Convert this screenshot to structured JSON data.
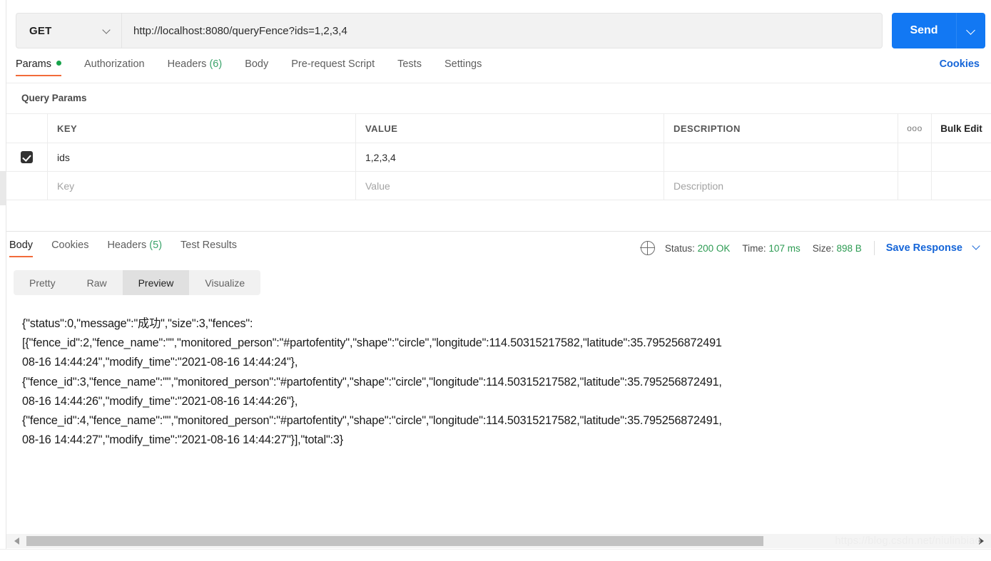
{
  "request": {
    "method": "GET",
    "url": "http://localhost:8080/queryFence?ids=1,2,3,4",
    "send_label": "Send",
    "tabs": [
      {
        "label": "Params",
        "badge_dot": true,
        "active": true
      },
      {
        "label": "Authorization",
        "active": false
      },
      {
        "label": "Headers",
        "count": "(6)",
        "active": false
      },
      {
        "label": "Body",
        "active": false
      },
      {
        "label": "Pre-request Script",
        "active": false
      },
      {
        "label": "Tests",
        "active": false
      },
      {
        "label": "Settings",
        "active": false
      }
    ],
    "cookies_link": "Cookies"
  },
  "query_params": {
    "section_title": "Query Params",
    "headers": {
      "key": "KEY",
      "value": "VALUE",
      "description": "DESCRIPTION",
      "more_icon": "ooo",
      "bulk_edit": "Bulk Edit"
    },
    "rows": [
      {
        "checked": true,
        "key": "ids",
        "value": "1,2,3,4",
        "description": ""
      }
    ],
    "placeholders": {
      "key": "Key",
      "value": "Value",
      "description": "Description"
    }
  },
  "response": {
    "tabs": [
      {
        "label": "Body",
        "active": true
      },
      {
        "label": "Cookies",
        "active": false
      },
      {
        "label": "Headers",
        "count": "(5)",
        "active": false
      },
      {
        "label": "Test Results",
        "active": false
      }
    ],
    "status": {
      "status_label": "Status:",
      "status_value": "200 OK",
      "time_label": "Time:",
      "time_value": "107 ms",
      "size_label": "Size:",
      "size_value": "898 B",
      "save_response": "Save Response"
    },
    "format_tabs": [
      {
        "label": "Pretty",
        "active": false
      },
      {
        "label": "Raw",
        "active": false
      },
      {
        "label": "Preview",
        "active": true
      },
      {
        "label": "Visualize",
        "active": false
      }
    ],
    "body_text": "{\"status\":0,\"message\":\"成功\",\"size\":3,\"fences\":\n[{\"fence_id\":2,\"fence_name\":\"\",\"monitored_person\":\"#partofentity\",\"shape\":\"circle\",\"longitude\":114.50315217582,\"latitude\":35.795256872491\n08-16 14:44:24\",\"modify_time\":\"2021-08-16 14:44:24\"},\n{\"fence_id\":3,\"fence_name\":\"\",\"monitored_person\":\"#partofentity\",\"shape\":\"circle\",\"longitude\":114.50315217582,\"latitude\":35.795256872491,\n08-16 14:44:26\",\"modify_time\":\"2021-08-16 14:44:26\"},\n{\"fence_id\":4,\"fence_name\":\"\",\"monitored_person\":\"#partofentity\",\"shape\":\"circle\",\"longitude\":114.50315217582,\"latitude\":35.795256872491,\n08-16 14:44:27\",\"modify_time\":\"2021-08-16 14:44:27\"}],\"total\":3}"
  },
  "watermark": "https://blog.csdn.net/niulinbiao",
  "colors": {
    "accent_orange": "#f26b3a",
    "brand_blue": "#1278f3",
    "link_blue": "#1565d8",
    "success_green": "#2c9b52",
    "dot_green": "#17a34a"
  }
}
